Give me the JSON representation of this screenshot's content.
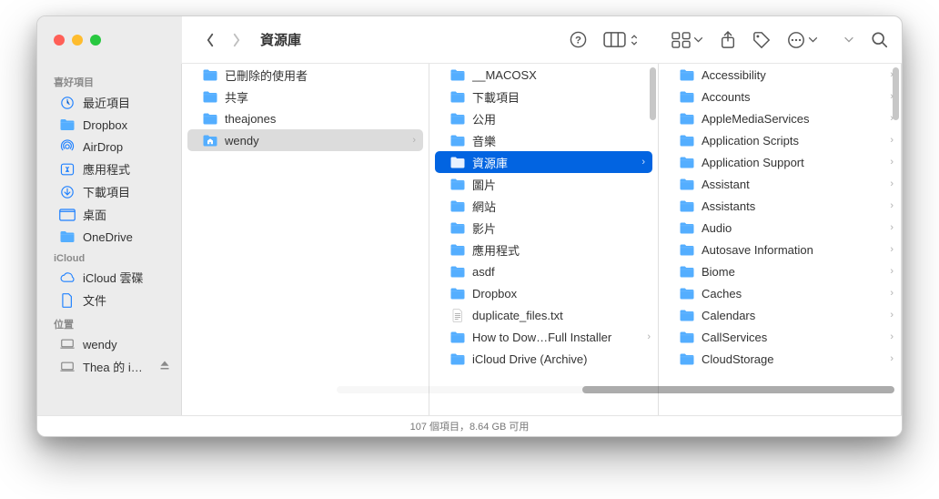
{
  "window": {
    "title": "資源庫"
  },
  "sidebar": {
    "sections": [
      {
        "title": "喜好項目",
        "items": [
          {
            "label": "最近項目",
            "icon": "clock"
          },
          {
            "label": "Dropbox",
            "icon": "folder"
          },
          {
            "label": "AirDrop",
            "icon": "airdrop"
          },
          {
            "label": "應用程式",
            "icon": "apps"
          },
          {
            "label": "下載項目",
            "icon": "download"
          },
          {
            "label": "桌面",
            "icon": "desktop"
          },
          {
            "label": "OneDrive",
            "icon": "folder"
          }
        ]
      },
      {
        "title": "iCloud",
        "items": [
          {
            "label": "iCloud 雲碟",
            "icon": "cloud"
          },
          {
            "label": "文件",
            "icon": "doc"
          }
        ]
      },
      {
        "title": "位置",
        "items": [
          {
            "label": "wendy",
            "icon": "laptop",
            "gray": true
          },
          {
            "label": "Thea 的 i…",
            "icon": "laptop",
            "gray": true,
            "eject": true
          }
        ]
      }
    ]
  },
  "columns": {
    "col1": [
      {
        "label": "已刪除的使用者",
        "type": "folder"
      },
      {
        "label": "共享",
        "type": "folder"
      },
      {
        "label": "theajones",
        "type": "folder"
      },
      {
        "label": "wendy",
        "type": "home",
        "selected": "gray",
        "chev": true
      }
    ],
    "col2": [
      {
        "label": "__MACOSX",
        "type": "folder"
      },
      {
        "label": "下載項目",
        "type": "folder"
      },
      {
        "label": "公用",
        "type": "folder"
      },
      {
        "label": "音樂",
        "type": "folder"
      },
      {
        "label": "資源庫",
        "type": "folder",
        "selected": "blue",
        "chev": true
      },
      {
        "label": "圖片",
        "type": "folder"
      },
      {
        "label": "網站",
        "type": "folder"
      },
      {
        "label": "影片",
        "type": "folder"
      },
      {
        "label": "應用程式",
        "type": "folder"
      },
      {
        "label": "asdf",
        "type": "folder"
      },
      {
        "label": "Dropbox",
        "type": "folder"
      },
      {
        "label": "duplicate_files.txt",
        "type": "txt"
      },
      {
        "label": "How to Dow…Full Installer",
        "type": "folder",
        "chev": true
      },
      {
        "label": "iCloud Drive (Archive)",
        "type": "folder"
      }
    ],
    "col3": [
      {
        "label": "Accessibility",
        "type": "folder",
        "chev": true
      },
      {
        "label": "Accounts",
        "type": "folder",
        "chev": true
      },
      {
        "label": "AppleMediaServices",
        "type": "folder",
        "chev": true
      },
      {
        "label": "Application Scripts",
        "type": "folder",
        "chev": true
      },
      {
        "label": "Application Support",
        "type": "folder",
        "chev": true
      },
      {
        "label": "Assistant",
        "type": "folder",
        "chev": true
      },
      {
        "label": "Assistants",
        "type": "folder",
        "chev": true
      },
      {
        "label": "Audio",
        "type": "folder",
        "chev": true
      },
      {
        "label": "Autosave Information",
        "type": "folder",
        "chev": true
      },
      {
        "label": "Biome",
        "type": "folder",
        "chev": true
      },
      {
        "label": "Caches",
        "type": "folder",
        "chev": true
      },
      {
        "label": "Calendars",
        "type": "folder",
        "chev": true
      },
      {
        "label": "CallServices",
        "type": "folder",
        "chev": true
      },
      {
        "label": "CloudStorage",
        "type": "folder",
        "chev": true
      }
    ]
  },
  "status": {
    "text": "107 個項目，8.64 GB 可用"
  }
}
